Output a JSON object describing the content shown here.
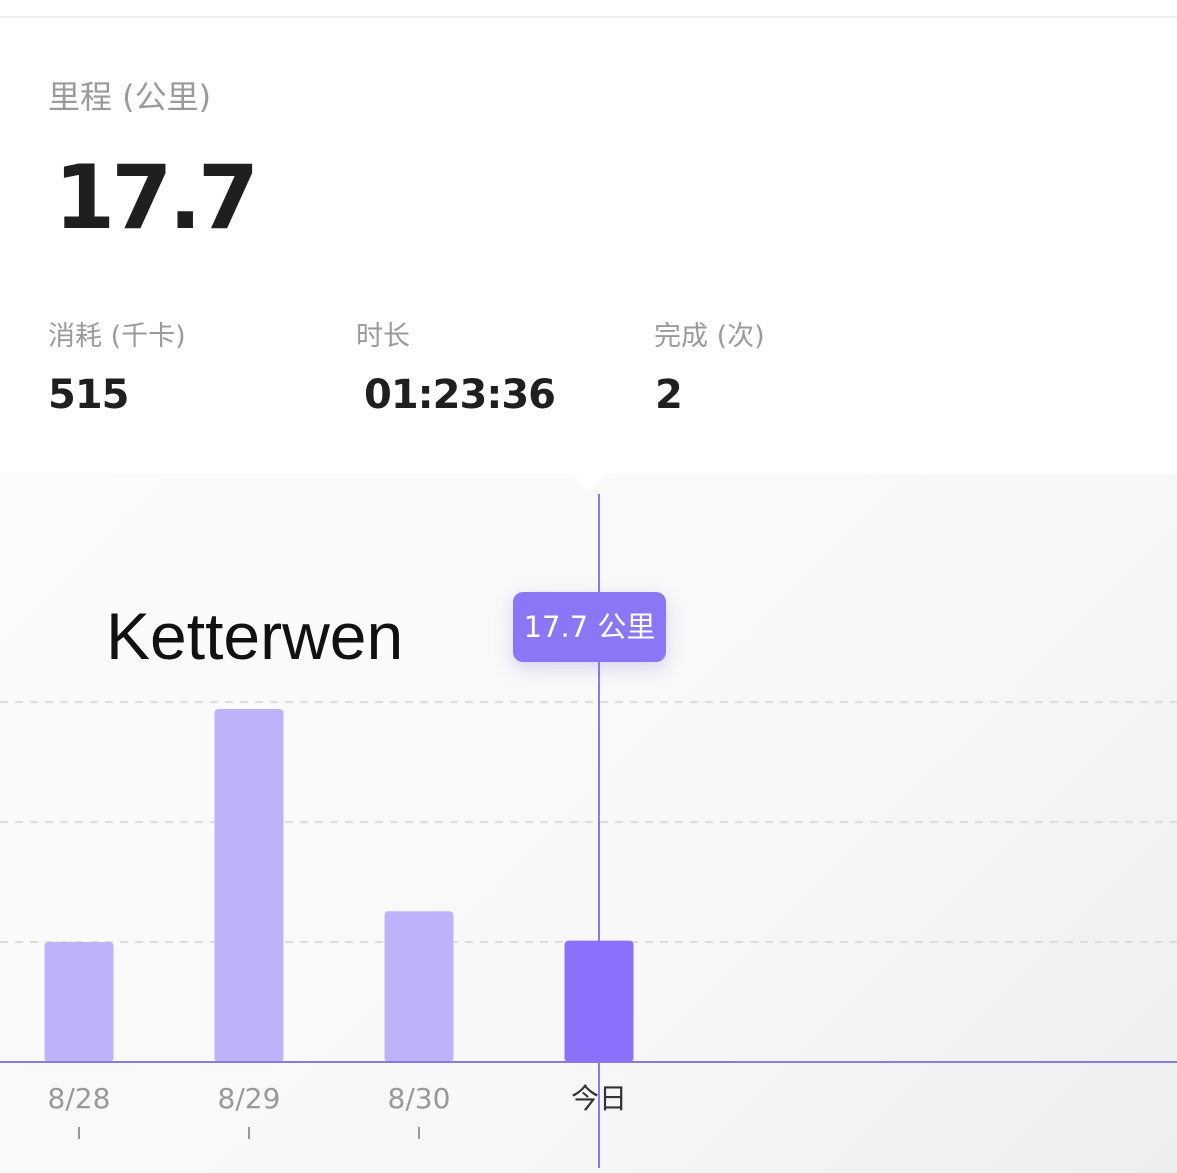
{
  "summary": {
    "distance_label": "里程 (公里)",
    "distance_value": "17.7",
    "stats": [
      {
        "label": "消耗 (千卡)",
        "value": "515"
      },
      {
        "label": "时长",
        "value": "01:23:36"
      },
      {
        "label": "完成 (次)",
        "value": "2"
      }
    ]
  },
  "overlay_text": "Ketterwen",
  "tooltip_text": "17.7 公里",
  "colors": {
    "bar": "#bdb3fa",
    "bar_selected": "#8a70fa",
    "cursor": "#8a7ae6",
    "baseline": "#8a7ae6",
    "grid": "#dcdcdc"
  },
  "chart_data": {
    "type": "bar",
    "categories": [
      "8/28",
      "8/29",
      "8/30",
      "今日"
    ],
    "values": [
      17.5,
      51.5,
      22.0,
      17.7
    ],
    "selected_index": 3,
    "ylim": [
      0,
      54
    ],
    "grid": true,
    "gridlines": [
      17.5,
      35,
      52.5
    ],
    "title": "",
    "xlabel": "",
    "ylabel": ""
  }
}
